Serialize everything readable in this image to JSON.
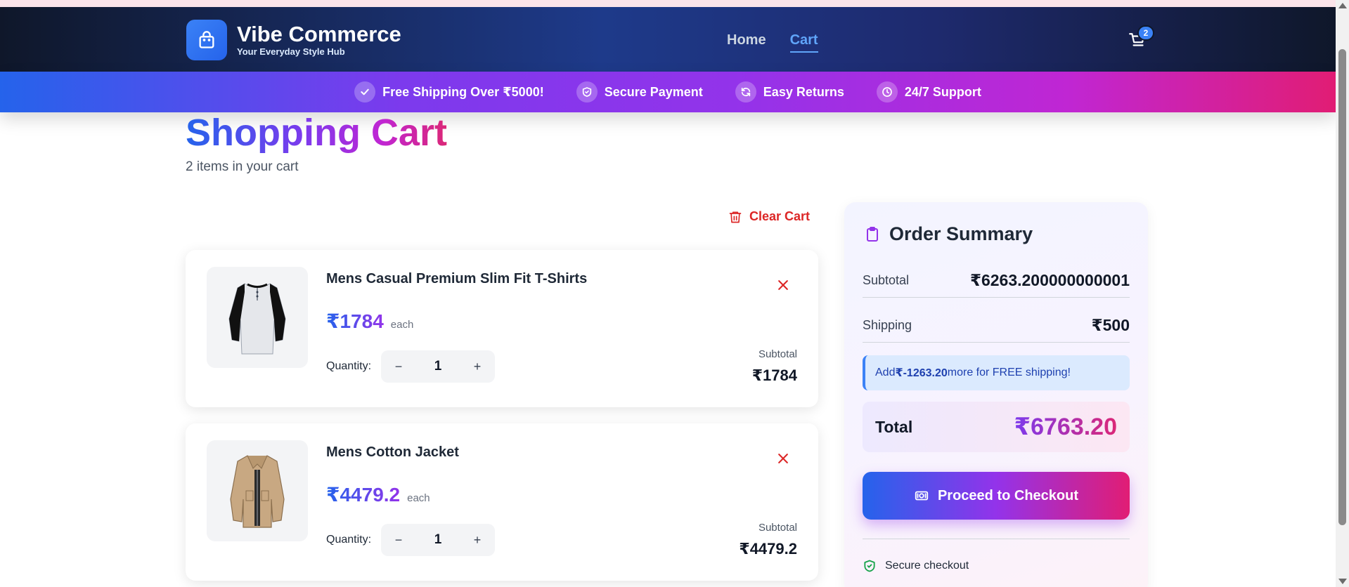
{
  "brand": {
    "name": "Vibe Commerce",
    "tagline": "Your Everyday Style Hub",
    "logo_icon": "shopping-bag-icon"
  },
  "nav": {
    "links": [
      {
        "label": "Home",
        "active": false
      },
      {
        "label": "Cart",
        "active": true
      }
    ],
    "cart_count": "2"
  },
  "perks": [
    {
      "icon": "check-circle-icon",
      "label": "Free Shipping Over ₹5000!"
    },
    {
      "icon": "shield-icon",
      "label": "Secure Payment"
    },
    {
      "icon": "refresh-icon",
      "label": "Easy Returns"
    },
    {
      "icon": "clock-icon",
      "label": "24/7 Support"
    }
  ],
  "page": {
    "title": "Shopping Cart",
    "subtitle": "2 items in your cart"
  },
  "clear_cart_label": "Clear Cart",
  "cart_items": [
    {
      "name": "Mens Casual Premium Slim Fit T-Shirts",
      "price": "₹1784",
      "each_label": "each",
      "quantity_label": "Quantity:",
      "quantity": "1",
      "subtotal_label": "Subtotal",
      "subtotal": "₹1784"
    },
    {
      "name": "Mens Cotton Jacket",
      "price": "₹4479.2",
      "each_label": "each",
      "quantity_label": "Quantity:",
      "quantity": "1",
      "subtotal_label": "Subtotal",
      "subtotal": "₹4479.2"
    }
  ],
  "stepper": {
    "decrement": "−",
    "increment": "+"
  },
  "summary": {
    "title": "Order Summary",
    "subtotal_label": "Subtotal",
    "subtotal_value": "₹6263.200000000001",
    "shipping_label": "Shipping",
    "shipping_value": "₹500",
    "shipping_note_prefix": "Add ",
    "shipping_note_amount": "₹-1263.20",
    "shipping_note_suffix": " more for FREE shipping!",
    "total_label": "Total",
    "total_value": "₹6763.20",
    "checkout_label": "Proceed to Checkout",
    "secure_label": "Secure checkout"
  },
  "colors": {
    "accent_blue": "#2563eb",
    "accent_purple": "#9333ea",
    "accent_pink": "#e11d74",
    "danger": "#dc2626",
    "success": "#16a34a"
  }
}
